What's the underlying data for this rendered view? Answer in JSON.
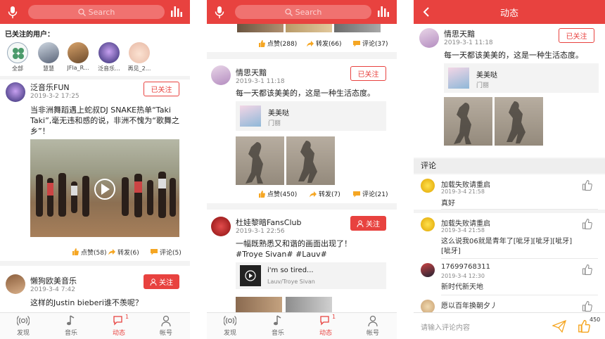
{
  "search": {
    "placeholder": "Search"
  },
  "s1": {
    "following_title": "已关注的用户：",
    "following": [
      {
        "name": "全部"
      },
      {
        "name": "慧慧"
      },
      {
        "name": "JFla_R..."
      },
      {
        "name": "泛音乐..."
      },
      {
        "name": "再见_2..."
      }
    ],
    "post1": {
      "name": "泛音乐FUN",
      "time": "2019-3-2 17:25",
      "follow": "已关注",
      "text": "当非洲舞蹈遇上蛇叔DJ SNAKE热单“Taki Taki”,毫无违和感的说，非洲不愧为“歌舞之乡”！",
      "likes": "点赞(58)",
      "shares": "转发(6)",
      "comments": "评论(5)"
    },
    "post2": {
      "name": "懒狗欧美音乐",
      "time": "2019-3-4 7:42",
      "follow": "关注",
      "text": "这样的Justin bieberi谁不羡呢？"
    }
  },
  "s2": {
    "topactions": {
      "likes": "点赞(288)",
      "shares": "转发(66)",
      "comments": "评论(37)"
    },
    "post1": {
      "name": "情思天黯",
      "time": "2019-3-1 11:18",
      "follow": "已关注",
      "text": "每一天都该美美的，这是一种生活态度。",
      "shared_name": "美美哒",
      "shared_sub": "门丽",
      "likes": "点赞(450)",
      "shares": "转发(7)",
      "comments": "评论(21)"
    },
    "post2": {
      "name": "杜娃黎暗FansClub",
      "time": "2019-3-1 22:56",
      "follow": "关注",
      "text": "一幅既熟悉又和谐的画面出现了！ #Troye Sivan# #Lauv#",
      "song_title": "i'm so tired...",
      "song_artist": "Lauv/Troye Sivan"
    }
  },
  "s3": {
    "title": "动态",
    "post": {
      "name": "情思天黯",
      "time": "2019-3-1 11:18",
      "follow": "已关注",
      "text": "每一天都该美美的，这是一种生活态度。",
      "shared_name": "美美哒",
      "shared_sub": "门丽"
    },
    "comments_title": "评论",
    "comments": [
      {
        "user": "加载失败请重启",
        "time": "2019-3-4 21:58",
        "body": "真好"
      },
      {
        "user": "加载失败请重启",
        "time": "2019-3-4 21:58",
        "body": "这么说我06就是青年了[呲牙][呲牙][呲牙][呲牙]"
      },
      {
        "user": "17699768311",
        "time": "2019-3-4 12:30",
        "body": "新时代新天地"
      },
      {
        "user": "愿以百年换朝夕丿",
        "time": "",
        "body": ""
      }
    ],
    "input_placeholder": "请输入评论内容",
    "like_count": "450"
  },
  "tabs": [
    "发现",
    "音乐",
    "动态",
    "帐号"
  ],
  "badge": "1",
  "colors": {
    "accent": "#e8423f"
  }
}
